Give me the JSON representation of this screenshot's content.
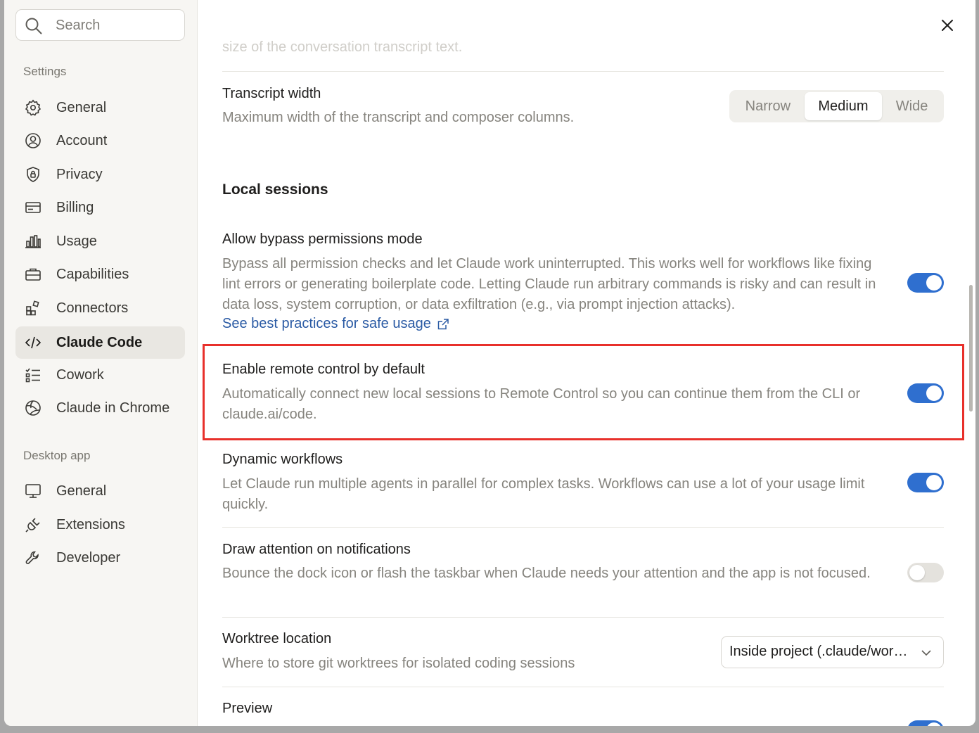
{
  "search": {
    "placeholder": "Search"
  },
  "sidebar": {
    "settings_label": "Settings",
    "settings_items": [
      {
        "label": "General",
        "icon": "gear-icon"
      },
      {
        "label": "Account",
        "icon": "user-circle-icon"
      },
      {
        "label": "Privacy",
        "icon": "shield-lock-icon"
      },
      {
        "label": "Billing",
        "icon": "credit-card-icon"
      },
      {
        "label": "Usage",
        "icon": "bar-chart-icon"
      },
      {
        "label": "Capabilities",
        "icon": "briefcase-icon"
      },
      {
        "label": "Connectors",
        "icon": "blocks-icon"
      },
      {
        "label": "Claude Code",
        "icon": "code-icon",
        "active": true
      },
      {
        "label": "Cowork",
        "icon": "checklist-icon"
      },
      {
        "label": "Claude in Chrome",
        "icon": "globe-icon"
      }
    ],
    "desktop_label": "Desktop app",
    "desktop_items": [
      {
        "label": "General",
        "icon": "monitor-icon"
      },
      {
        "label": "Extensions",
        "icon": "plug-icon"
      },
      {
        "label": "Developer",
        "icon": "wrench-icon"
      }
    ]
  },
  "main": {
    "faded_text": "size of the conversation transcript text.",
    "transcript_width": {
      "title": "Transcript width",
      "desc": "Maximum width of the transcript and composer columns.",
      "options": [
        "Narrow",
        "Medium",
        "Wide"
      ],
      "selected": "Medium"
    },
    "local_sessions_heading": "Local sessions",
    "bypass": {
      "title": "Allow bypass permissions mode",
      "desc": "Bypass all permission checks and let Claude work uninterrupted. This works well for workflows like fixing lint errors or generating boilerplate code. Letting Claude run arbitrary commands is risky and can result in data loss, system corruption, or data exfiltration (e.g., via prompt injection attacks).",
      "link": "See best practices for safe usage",
      "enabled": true
    },
    "remote_control": {
      "title": "Enable remote control by default",
      "desc": "Automatically connect new local sessions to Remote Control so you can continue them from the CLI or claude.ai/code.",
      "enabled": true
    },
    "dynamic_workflows": {
      "title": "Dynamic workflows",
      "desc": "Let Claude run multiple agents in parallel for complex tasks. Workflows can use a lot of your usage limit quickly.",
      "enabled": true
    },
    "draw_attention": {
      "title": "Draw attention on notifications",
      "desc": "Bounce the dock icon or flash the taskbar when Claude needs your attention and the app is not focused.",
      "enabled": false
    },
    "worktree": {
      "title": "Worktree location",
      "desc": "Where to store git worktrees for isolated coding sessions",
      "value": "Inside project (.claude/worktrees)"
    },
    "preview": {
      "title": "Preview",
      "enabled": true
    }
  },
  "colors": {
    "accent": "#2f6fcf",
    "highlight_border": "#e8302b",
    "link": "#2a5aa4"
  }
}
